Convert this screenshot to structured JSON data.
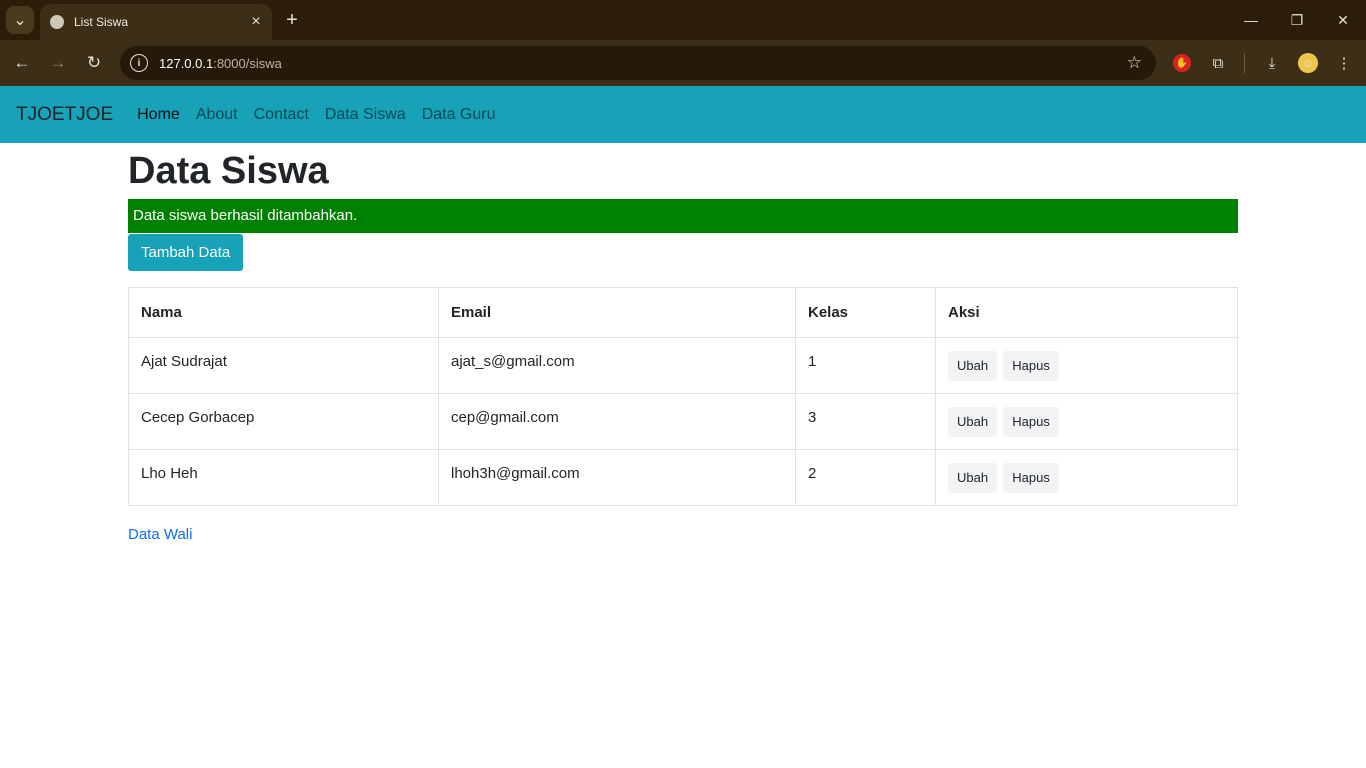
{
  "browser": {
    "tab_title": "List Siswa",
    "tab_close": "×",
    "new_tab": "+",
    "url_host": "127.0.0.1",
    "url_path": ":8000/siswa",
    "controls": {
      "minimize": "—",
      "restore": "❐",
      "close": "✕"
    }
  },
  "navbar": {
    "brand": "TJOETJOE",
    "links": [
      "Home",
      "About",
      "Contact",
      "Data Siswa",
      "Data Guru"
    ],
    "active": "Home"
  },
  "main": {
    "heading": "Data Siswa",
    "alert": "Data siswa berhasil ditambahkan.",
    "add_button": "Tambah Data",
    "table": {
      "headers": [
        "Nama",
        "Email",
        "Kelas",
        "Aksi"
      ],
      "rows": [
        {
          "nama": "Ajat Sudrajat",
          "email": "ajat_s@gmail.com",
          "kelas": "1",
          "edit": "Ubah",
          "delete": "Hapus"
        },
        {
          "nama": "Cecep Gorbacep",
          "email": "cep@gmail.com",
          "kelas": "3",
          "edit": "Ubah",
          "delete": "Hapus"
        },
        {
          "nama": "Lho Heh",
          "email": "lhoh3h@gmail.com",
          "kelas": "2",
          "edit": "Ubah",
          "delete": "Hapus"
        }
      ]
    },
    "footer_link": "Data Wali"
  },
  "colors": {
    "navbar": "#17a2b8",
    "alert": "#008000",
    "link": "#0d6efd"
  },
  "icons": [
    "tab-search-icon",
    "globe-icon",
    "back-icon",
    "forward-icon",
    "reload-icon",
    "info-icon",
    "star-icon",
    "extension-icon",
    "download-icon",
    "menu-icon"
  ]
}
